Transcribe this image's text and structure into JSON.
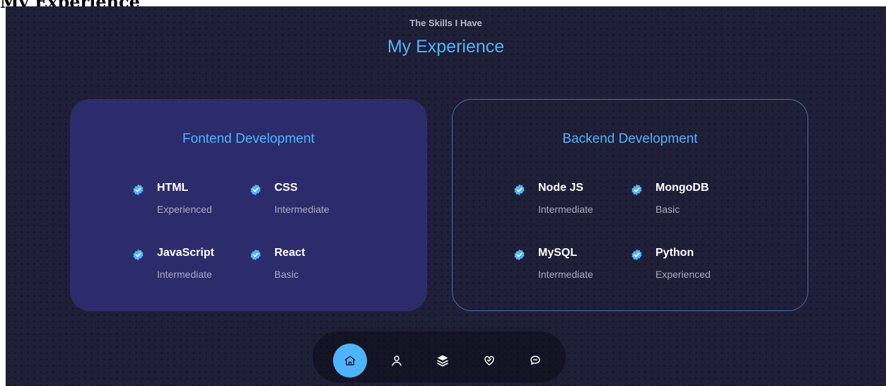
{
  "page": {
    "heading": "My Experience"
  },
  "section": {
    "subtitle": "The Skills I Have",
    "title": "My Experience"
  },
  "frontend": {
    "title": "Fontend Development",
    "skills": [
      {
        "name": "HTML",
        "level": "Experienced"
      },
      {
        "name": "CSS",
        "level": "Intermediate"
      },
      {
        "name": "JavaScript",
        "level": "Intermediate"
      },
      {
        "name": "React",
        "level": "Basic"
      }
    ]
  },
  "backend": {
    "title": "Backend Development",
    "skills": [
      {
        "name": "Node JS",
        "level": "Intermediate"
      },
      {
        "name": "MongoDB",
        "level": "Basic"
      },
      {
        "name": "MySQL",
        "level": "Intermediate"
      },
      {
        "name": "Python",
        "level": "Experienced"
      }
    ]
  },
  "nav": {
    "items": [
      {
        "icon": "home-icon",
        "active": true
      },
      {
        "icon": "user-icon",
        "active": false
      },
      {
        "icon": "layers-icon",
        "active": false
      },
      {
        "icon": "heart-handshake-icon",
        "active": false
      },
      {
        "icon": "message-icon",
        "active": false
      }
    ]
  },
  "colors": {
    "background": "#1f1f38",
    "accent": "#4db5ff",
    "card": "#2c2c6c",
    "muted_text": "#a9abbd"
  }
}
